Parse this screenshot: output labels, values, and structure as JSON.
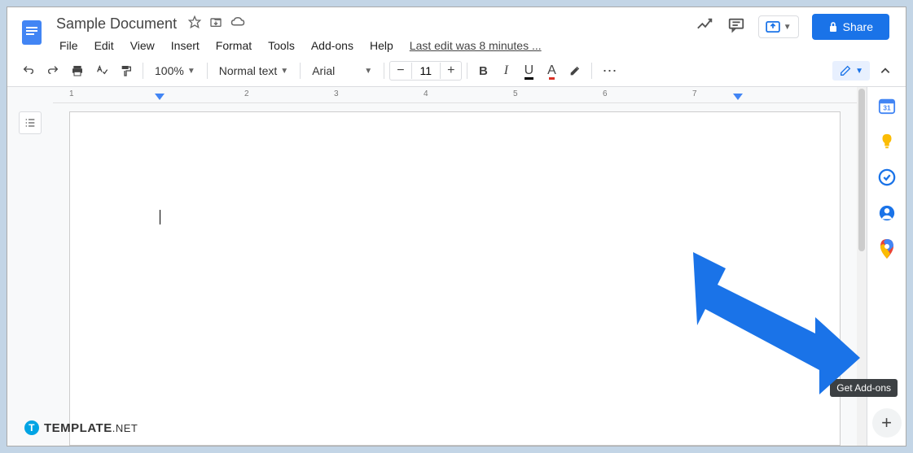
{
  "header": {
    "docTitle": "Sample Document",
    "lastEdit": "Last edit was 8 minutes ...",
    "shareLabel": "Share"
  },
  "menu": {
    "items": [
      "File",
      "Edit",
      "View",
      "Insert",
      "Format",
      "Tools",
      "Add-ons",
      "Help"
    ]
  },
  "toolbar": {
    "zoom": "100%",
    "style": "Normal text",
    "font": "Arial",
    "fontSize": "11",
    "bold": "B",
    "italic": "I",
    "underline": "U",
    "textColorLetter": "A",
    "more": "⋯"
  },
  "ruler": {
    "ticks": [
      "1",
      "2",
      "3",
      "4",
      "5",
      "6",
      "7"
    ]
  },
  "sidePanel": {
    "tooltip": "Get Add-ons",
    "calendarDate": "31"
  },
  "footer": {
    "brand": "TEMPLATE",
    "brandSuffix": ".NET"
  }
}
